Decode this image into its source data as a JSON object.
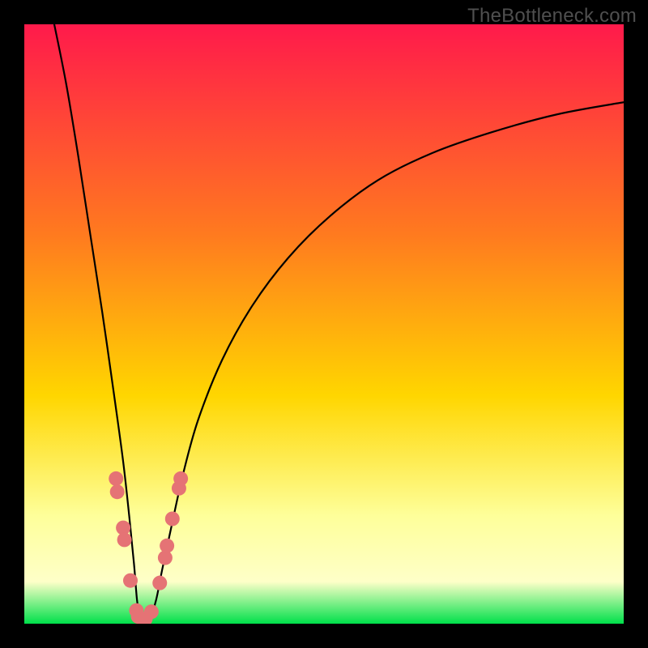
{
  "watermark": "TheBottleneck.com",
  "chart_data": {
    "type": "line",
    "title": "",
    "xlabel": "",
    "ylabel": "",
    "xlim": [
      0,
      100
    ],
    "ylim": [
      0,
      100
    ],
    "grid": false,
    "legend": false,
    "background_gradient": {
      "top": "#ff1a4b",
      "mid1": "#ff7a1f",
      "mid2": "#ffd600",
      "pale": "#feff9a",
      "bottom": "#00e04a"
    },
    "series": [
      {
        "name": "bottleneck-curve",
        "color": "#000000",
        "x": [
          5,
          7,
          9,
          11,
          13,
          15,
          16.5,
          17.5,
          18.3,
          18.8,
          19.3,
          20.0,
          21.0,
          22.0,
          23.0,
          24.5,
          26.5,
          29,
          33,
          38,
          44,
          51,
          59,
          68,
          78,
          89,
          100
        ],
        "y": [
          100,
          90,
          78,
          65,
          52,
          38,
          27,
          18,
          10,
          4,
          1,
          0,
          1,
          4,
          9,
          16,
          25,
          34,
          44,
          53,
          61,
          68,
          74,
          78.5,
          82,
          85,
          87
        ]
      }
    ],
    "markers": {
      "name": "highlight-dots",
      "color": "#e57375",
      "radius": 9,
      "points": [
        {
          "x": 15.3,
          "y": 24.2
        },
        {
          "x": 15.5,
          "y": 22.0
        },
        {
          "x": 16.5,
          "y": 16.0
        },
        {
          "x": 16.7,
          "y": 14.0
        },
        {
          "x": 17.7,
          "y": 7.2
        },
        {
          "x": 18.7,
          "y": 2.2
        },
        {
          "x": 19.0,
          "y": 1.2
        },
        {
          "x": 20.2,
          "y": 0.8
        },
        {
          "x": 21.2,
          "y": 2.0
        },
        {
          "x": 22.6,
          "y": 6.8
        },
        {
          "x": 23.5,
          "y": 11.0
        },
        {
          "x": 23.8,
          "y": 13.0
        },
        {
          "x": 24.7,
          "y": 17.5
        },
        {
          "x": 25.8,
          "y": 22.6
        },
        {
          "x": 26.1,
          "y": 24.2
        }
      ]
    }
  }
}
